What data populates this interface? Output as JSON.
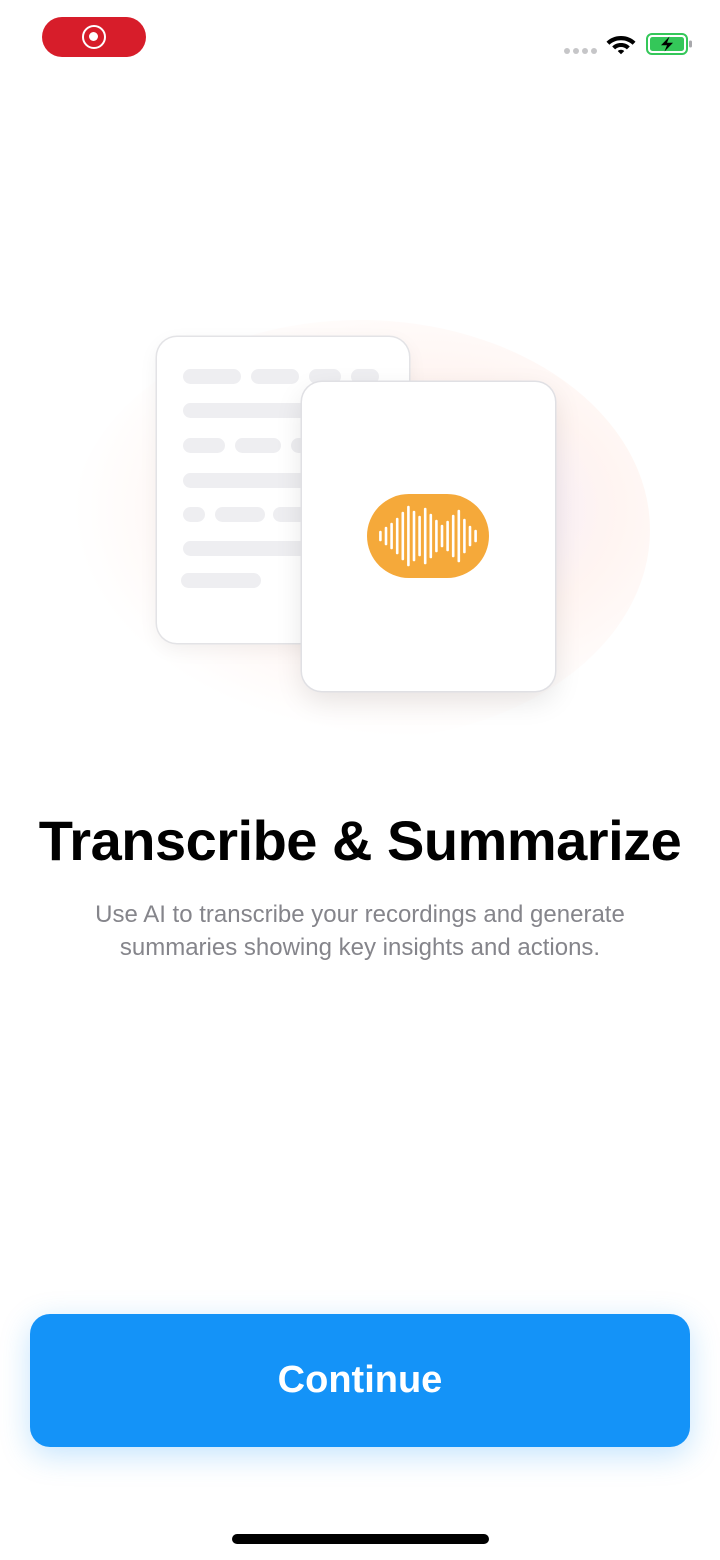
{
  "status_bar": {
    "recording_icon": "screen-recording-icon",
    "wifi_icon": "wifi-icon",
    "battery_icon": "battery-charging-icon",
    "recording_color": "#d71d2a",
    "battery_color": "#34c759"
  },
  "illustration": {
    "document_icon": "transcript-document-icon",
    "audio_icon": "audio-waveform-icon",
    "wave_color": "#f5a93a"
  },
  "onboarding": {
    "title": "Transcribe & Summarize",
    "subtitle": "Use AI to transcribe your recordings and generate summaries showing key insights and actions."
  },
  "actions": {
    "continue_label": "Continue",
    "accent_color": "#1493f8"
  }
}
